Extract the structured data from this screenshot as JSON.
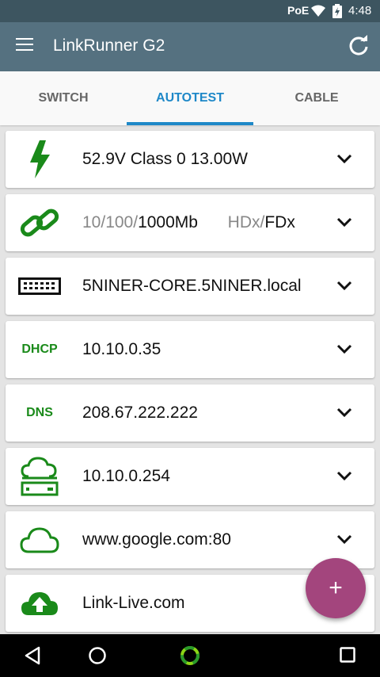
{
  "status_bar": {
    "poe": "PoE",
    "time": "4:48",
    "icons": [
      "wifi-icon",
      "battery-icon"
    ]
  },
  "app_bar": {
    "title": "LinkRunner G2",
    "icons": [
      "menu-icon",
      "refresh-icon"
    ]
  },
  "tabs": [
    {
      "label": "SWITCH",
      "active": false
    },
    {
      "label": "AUTOTEST",
      "active": true
    },
    {
      "label": "CABLE",
      "active": false
    }
  ],
  "cards": {
    "poe": {
      "text": "52.9V  Class 0  13.00W",
      "icon": "lightning-icon"
    },
    "link": {
      "speed_dim": "10/100/",
      "speed_active": "1000Mb",
      "duplex_dim": "HDx/",
      "duplex_active": "FDx",
      "icon": "link-icon"
    },
    "switch": {
      "text": "5NINER-CORE.5NINER.local",
      "icon": "switch-icon"
    },
    "dhcp": {
      "label": "DHCP",
      "text": "10.10.0.35"
    },
    "dns": {
      "label": "DNS",
      "text": "208.67.222.222"
    },
    "gateway": {
      "text": "10.10.0.254",
      "icon": "gateway-cloud-icon"
    },
    "target": {
      "text": "www.google.com:80",
      "icon": "cloud-icon"
    },
    "upload": {
      "text": "Link-Live.com",
      "icon": "cloud-upload-icon"
    }
  },
  "fab": {
    "label": "+"
  },
  "colors": {
    "accent": "#1e88c8",
    "green": "#1a8a1a",
    "fab": "#a3457d",
    "app_bar": "#557180"
  }
}
